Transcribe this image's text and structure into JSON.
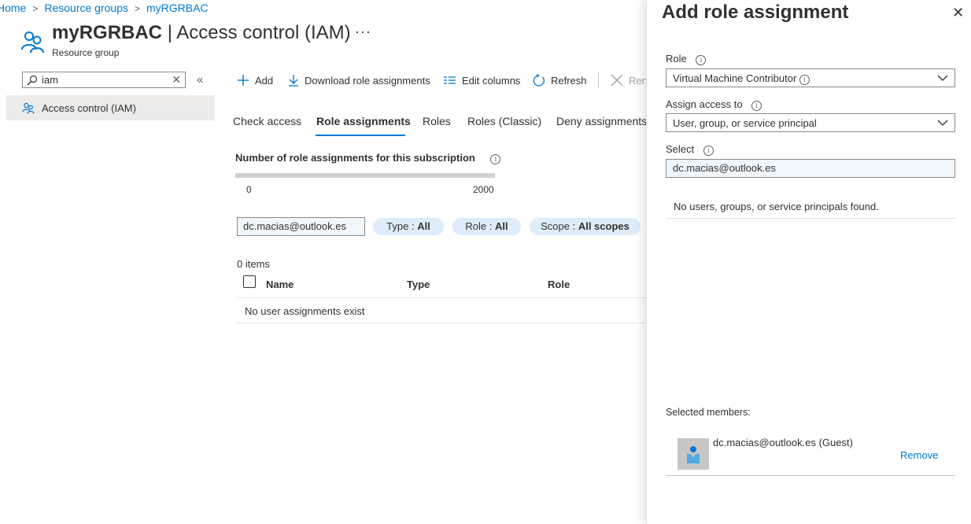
{
  "breadcrumb": {
    "items": [
      "Home",
      "Resource groups",
      "myRGRBAC"
    ],
    "separator": ">"
  },
  "header": {
    "resource_name": "myRGRBAC",
    "section_title": "| Access control (IAM)",
    "more_label": "···",
    "subtitle": "Resource group"
  },
  "sidebar": {
    "search_value": "iam",
    "clear_label": "✕",
    "collapse_label": "«",
    "items": [
      {
        "label": "Access control (IAM)",
        "selected": true
      }
    ]
  },
  "toolbar": {
    "add": "Add",
    "download": "Download role assignments",
    "edit_columns": "Edit columns",
    "refresh": "Refresh",
    "remove_partial": "Ren"
  },
  "tabs": [
    "Check access",
    "Role assignments",
    "Roles",
    "Roles (Classic)",
    "Deny assignments"
  ],
  "active_tab": "Role assignments",
  "counter": {
    "title": "Number of role assignments for this subscription",
    "info": "i",
    "current": 0,
    "min_label": "0",
    "max_label": "2000",
    "fill_fraction": 0
  },
  "filters": {
    "search_value": "dc.macias@outlook.es",
    "pills": [
      {
        "key": "Type : ",
        "value": "All"
      },
      {
        "key": "Role : ",
        "value": "All"
      },
      {
        "key": "Scope : ",
        "value": "All scopes"
      }
    ]
  },
  "table": {
    "items_count": "0 items",
    "columns": [
      "Name",
      "Type",
      "Role"
    ],
    "empty_message": "No user assignments exist"
  },
  "panel": {
    "title": "Add role assignment",
    "close_label": "✕",
    "role_label": "Role",
    "role_value": "Virtual Machine Contributor",
    "assign_label": "Assign access to",
    "assign_value": "User, group, or service principal",
    "select_label": "Select",
    "select_value": "dc.macias@outlook.es",
    "no_results": "No users, groups, or service principals found.",
    "selected_members_label": "Selected members:",
    "members": [
      {
        "name": "dc.macias@outlook.es (Guest)",
        "remove_label": "Remove"
      }
    ]
  },
  "colors": {
    "accent": "#0078d4",
    "pill_bg": "#deecf9",
    "selected_nav_bg": "#edebe9"
  }
}
